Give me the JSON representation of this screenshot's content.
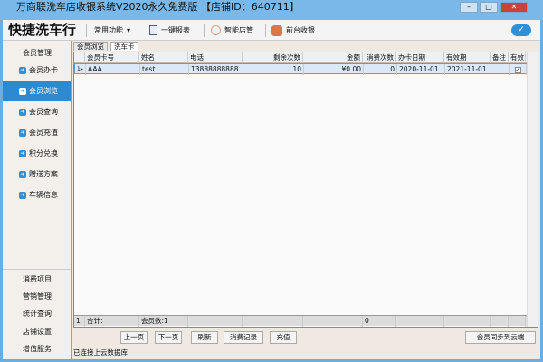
{
  "window": {
    "title": "万商联洗车店收银系统V2020永久免费版 【店铺ID：640711】",
    "min": "–",
    "max": "□",
    "close": "✕"
  },
  "toolbar": {
    "brand": "快捷洗车行",
    "common": "常用功能",
    "common_caret": "▾",
    "report": "一键报表",
    "smart": "智能店管",
    "cashier": "前台收银"
  },
  "sidebar": {
    "header": "会员管理",
    "items": [
      {
        "label": "会员办卡"
      },
      {
        "label": "会员浏览",
        "selected": true
      },
      {
        "label": "会员查询"
      },
      {
        "label": "会员充值"
      },
      {
        "label": "积分兑换"
      },
      {
        "label": "赠送方案"
      },
      {
        "label": "车辆信息"
      }
    ],
    "bottom": [
      "消费项目",
      "营销管理",
      "统计查询",
      "店铺设置",
      "增值服务"
    ]
  },
  "tabs": [
    "会员浏览",
    "洗车卡"
  ],
  "grid": {
    "columns": [
      "会员卡号",
      "姓名",
      "电话",
      "剩余次数",
      "金额",
      "消费次数",
      "办卡日期",
      "有效期",
      "备注",
      "有效"
    ],
    "rows": [
      {
        "num": "1",
        "marker": "▸",
        "card": "AAA",
        "name": "test",
        "phone": "13888888888",
        "remaining": "10",
        "amount": "¥0.00",
        "consumed": "0",
        "issue_date": "2020-11-01",
        "expiry": "2021-11-01",
        "note": "",
        "valid": true
      }
    ],
    "totals": {
      "num": "1",
      "label": "合计:",
      "count": "会员数:1",
      "consumed": "0"
    }
  },
  "buttons": {
    "prev": "上一页",
    "next": "下一页",
    "refresh": "刷新",
    "records": "消费记录",
    "recharge": "充值",
    "sync": "会员同步到云端"
  },
  "status": "已连接上云数据库"
}
